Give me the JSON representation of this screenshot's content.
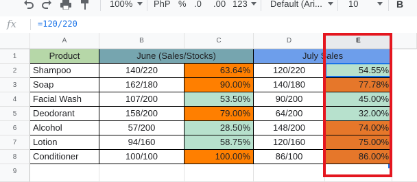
{
  "toolbar": {
    "zoom": "100%",
    "currency": "PhP",
    "percent": "%",
    "dec_decrease": ".0",
    "dec_increase": ".00",
    "more_formats": "123",
    "font": "Default (Ari...",
    "font_size": "10",
    "bold": "B"
  },
  "formula_bar": {
    "fx": "fx",
    "formula": "=120/220"
  },
  "columns": [
    "A",
    "B",
    "C",
    "D",
    "E"
  ],
  "header_row": {
    "number": "1",
    "product": "Product",
    "june": "June (Sales/Stocks)",
    "july": "July Sales"
  },
  "rows": [
    {
      "num": "2",
      "product": "Shampoo",
      "june": "140/220",
      "june_pct": "63.64%",
      "july": "120/220",
      "july_pct": "54.55%"
    },
    {
      "num": "3",
      "product": "Soap",
      "june": "162/180",
      "june_pct": "90.00%",
      "july": "140/180",
      "july_pct": "77.78%"
    },
    {
      "num": "4",
      "product": "Facial Wash",
      "june": "107/200",
      "june_pct": "53.50%",
      "july": "90/200",
      "july_pct": "45.00%"
    },
    {
      "num": "5",
      "product": "Deodorant",
      "june": "158/200",
      "june_pct": "79.00%",
      "july": "64/200",
      "july_pct": "32.00%"
    },
    {
      "num": "6",
      "product": "Alcohol",
      "june": "57/200",
      "june_pct": "28.50%",
      "july": "148/200",
      "july_pct": "74.00%"
    },
    {
      "num": "7",
      "product": "Lotion",
      "june": "94/160",
      "june_pct": "58.75%",
      "july": "120/160",
      "july_pct": "75.00%"
    },
    {
      "num": "8",
      "product": "Conditioner",
      "june": "100/100",
      "june_pct": "100.00%",
      "july": "86/100",
      "july_pct": "86.00%"
    }
  ],
  "empty_row": "9",
  "colors": {
    "product_header": "#b6d7a8",
    "june_header": "#76a5af",
    "july_header": "#6d9eeb",
    "orange_c": "#ff7f00",
    "orange_e": "#e6772a",
    "mint": "#b7e1cd",
    "highlight": "#e4161f",
    "selection": "#1a73e8"
  },
  "fills": {
    "june_pct": [
      "orange",
      "orange",
      "mint",
      "orange",
      "mint",
      "mint",
      "orange"
    ],
    "july_pct": [
      "mint",
      "orange",
      "mint",
      "mint",
      "orange",
      "orange",
      "orange"
    ]
  }
}
